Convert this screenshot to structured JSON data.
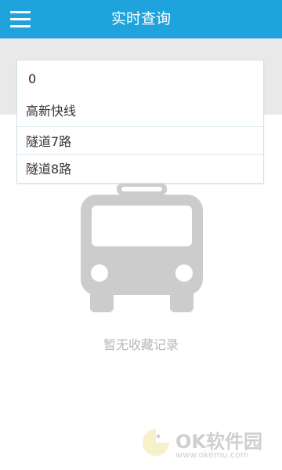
{
  "header": {
    "title": "实时查询",
    "menu_icon": "hamburger-menu-icon"
  },
  "search": {
    "value": "0",
    "suggestions": [
      "高新快线",
      "隧道7路",
      "隧道8路"
    ]
  },
  "empty_state": {
    "icon": "bus-icon",
    "message": "暂无收藏记录"
  },
  "watermark": {
    "brand": "OK软件园",
    "url": "www.okemu.com"
  },
  "colors": {
    "accent": "#1fa3dc",
    "band": "#e9e9e9",
    "muted_text": "#b7b7b7",
    "icon_gray": "#cccccc"
  }
}
